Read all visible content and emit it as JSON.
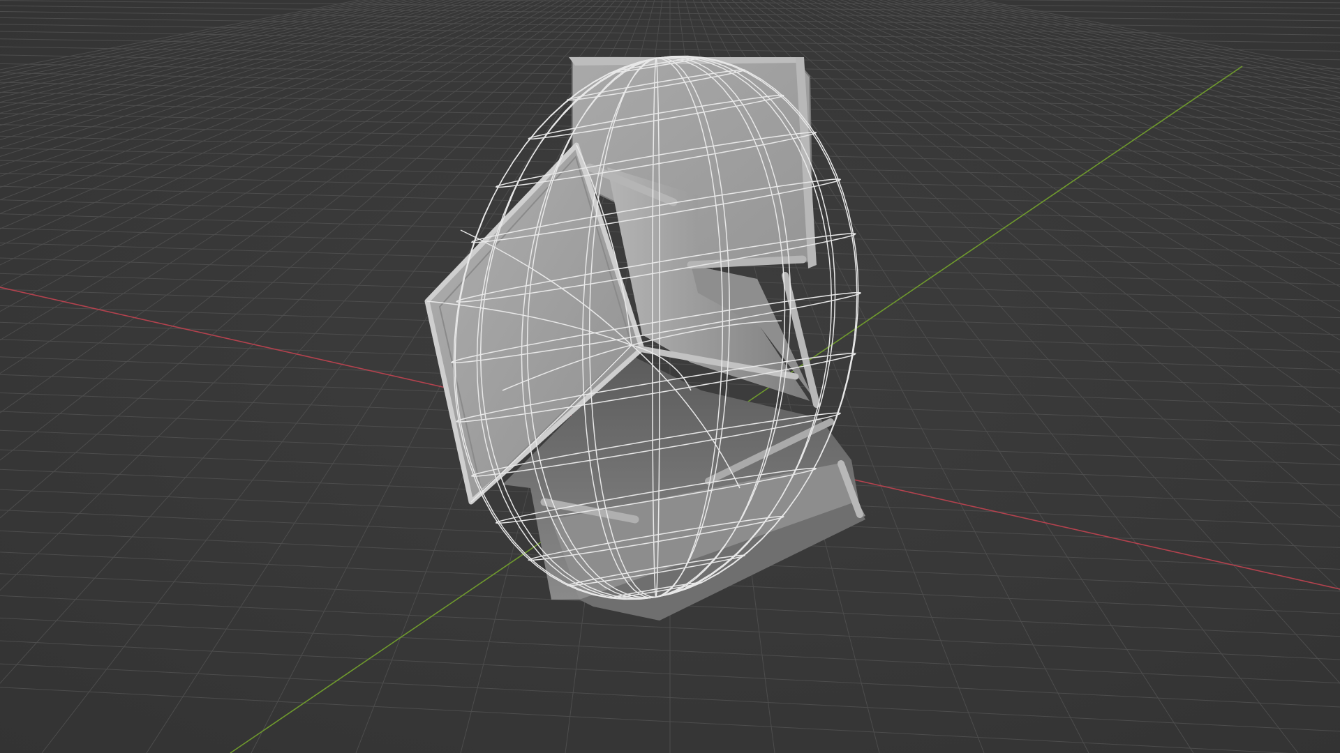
{
  "viewport": {
    "view": "3d-viewport",
    "background_color": "#393939",
    "grid_color": "#4d4d4d",
    "x_axis_color": "#b4424e",
    "y_axis_color": "#6f9a2d",
    "grid_visible": true
  },
  "object": {
    "solid_color": "#9c9c9c",
    "wireframe_color": "#e8e8e8",
    "wireframe_overlay": true,
    "shading": "solid"
  }
}
